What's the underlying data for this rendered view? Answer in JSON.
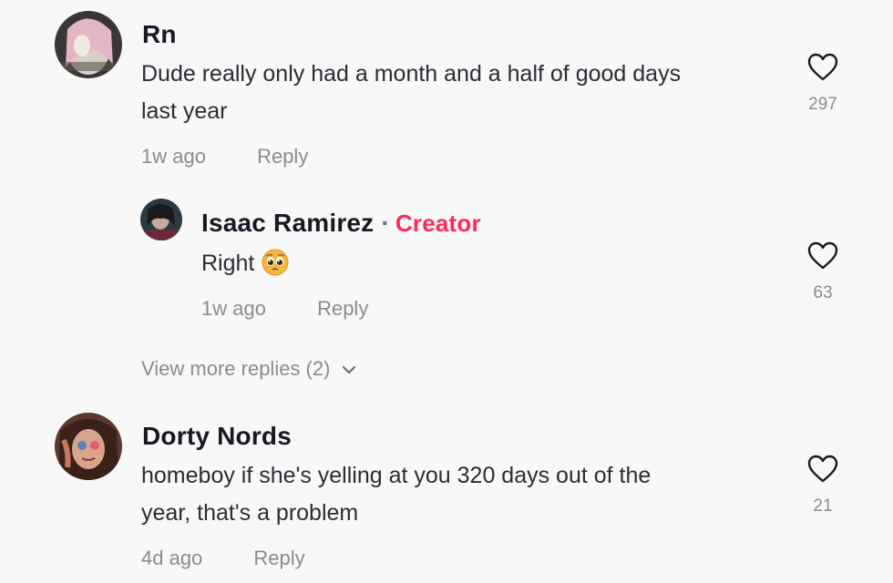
{
  "comments": [
    {
      "username": "Rn",
      "text_line1": "Dude really only had a month and a half of good days",
      "text_line2": "last year",
      "time": "1w ago",
      "reply_label": "Reply",
      "likes": "297",
      "replies": [
        {
          "username": "Isaac Ramirez",
          "separator": "·",
          "badge": "Creator",
          "text": "Right",
          "emoji": "pleading-face-emoji",
          "time": "1w ago",
          "reply_label": "Reply",
          "likes": "63"
        }
      ],
      "view_more": "View more replies (2)"
    },
    {
      "username": "Dorty Nords",
      "text_line1": "homeboy if she's yelling at you 320 days out of the",
      "text_line2": "year, that's a problem",
      "time": "4d ago",
      "reply_label": "Reply",
      "likes": "21"
    }
  ],
  "colors": {
    "background": "#f8f8f8",
    "creator_badge": "#fe2c55",
    "meta_text": "#8a8b91"
  },
  "icons": {
    "like": "heart-outline-icon",
    "expand": "chevron-down-icon"
  }
}
